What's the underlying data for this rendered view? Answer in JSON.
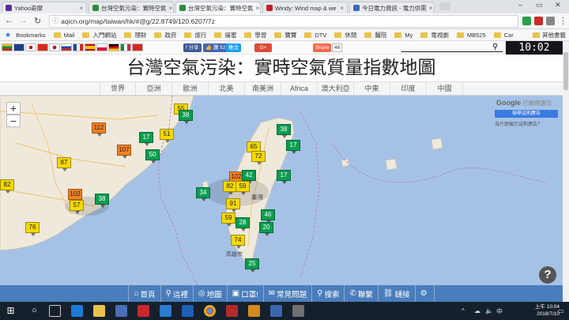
{
  "browser": {
    "tabs": [
      {
        "title": "Yahoo奇摩",
        "fav": "#5a2e9c",
        "active": false
      },
      {
        "title": "台灣空氣污染：實時空氣",
        "fav": "#2f8c3c",
        "active": false
      },
      {
        "title": "台灣空氣污染：實時空氣",
        "fav": "#2f8c3c",
        "active": true
      },
      {
        "title": "Windy: Wind map & we",
        "fav": "#c2202a",
        "active": false
      },
      {
        "title": "今日電力資訊 - 電力供需",
        "fav": "#3b6bb5",
        "active": false
      }
    ],
    "url": "aqicn.org/map/taiwan/hk/#@g/22.8749/120.6207/7z",
    "bookmarks": [
      "Bookmarks",
      "Mail",
      "入門網站",
      "理財",
      "政府",
      "旅行",
      "揚蜜",
      "學習",
      "寶寶",
      "DTV",
      "休閒",
      "醫院",
      "My",
      "電視劇",
      "MB525",
      "Car"
    ],
    "other_bookmarks": "其他書籤"
  },
  "site": {
    "share_fb": "分享",
    "tweet": "推文",
    "like_label": "讚",
    "like_count": "52",
    "gplus": "G+",
    "share_label": "Share",
    "share_count": "46",
    "clock": "10:02",
    "title": "台灣空氣污染：實時空氣質量指數地圖",
    "regions": [
      "世界",
      "亞洲",
      "歐洲",
      "北美",
      "南美洲",
      "Africa",
      "澳大利亞",
      "中東",
      "印度",
      "中國"
    ]
  },
  "map": {
    "google_logo": "Google",
    "google_sub": "已關閉廣告",
    "google_btn": "檢舉這則廣告",
    "google_note": "為什麼顯示這則廣告？",
    "help": "?",
    "city_label": "臺灣",
    "city_label2": "高雄市",
    "markers": [
      {
        "v": "55",
        "c": "#f5d800"
      },
      {
        "v": "38",
        "c": "#0a9e50"
      },
      {
        "v": "112",
        "c": "#f58220"
      },
      {
        "v": "51",
        "c": "#f5d800"
      },
      {
        "v": "17",
        "c": "#0a9e50"
      },
      {
        "v": "107",
        "c": "#f58220"
      },
      {
        "v": "50",
        "c": "#0a9e50"
      },
      {
        "v": "87",
        "c": "#f5d800"
      },
      {
        "v": "82",
        "c": "#f5d800"
      },
      {
        "v": "102",
        "c": "#f58220"
      },
      {
        "v": "57",
        "c": "#f5d800"
      },
      {
        "v": "38",
        "c": "#0a9e50"
      },
      {
        "v": "76",
        "c": "#f5d800"
      },
      {
        "v": "38",
        "c": "#0a9e50"
      },
      {
        "v": "17",
        "c": "#0a9e50"
      },
      {
        "v": "65",
        "c": "#f5d800"
      },
      {
        "v": "72",
        "c": "#f5d800"
      },
      {
        "v": "102",
        "c": "#f58220"
      },
      {
        "v": "42",
        "c": "#0a9e50"
      },
      {
        "v": "17",
        "c": "#0a9e50"
      },
      {
        "v": "82",
        "c": "#f5d800"
      },
      {
        "v": "59",
        "c": "#f5d800"
      },
      {
        "v": "34",
        "c": "#0a9e50"
      },
      {
        "v": "91",
        "c": "#f5d800"
      },
      {
        "v": "46",
        "c": "#0a9e50"
      },
      {
        "v": "59",
        "c": "#f5d800"
      },
      {
        "v": "28",
        "c": "#0a9e50"
      },
      {
        "v": "20",
        "c": "#0a9e50"
      },
      {
        "v": "74",
        "c": "#f5d800"
      },
      {
        "v": "25",
        "c": "#0a9e50"
      }
    ]
  },
  "bottom_nav": [
    {
      "icon": "home-icon",
      "glyph": "⌂",
      "label": "首頁"
    },
    {
      "icon": "pin-icon",
      "glyph": "⚲",
      "label": "這裡"
    },
    {
      "icon": "globe-icon",
      "glyph": "◎",
      "label": "地圖"
    },
    {
      "icon": "mask-icon",
      "glyph": "▣",
      "label": "口罩!"
    },
    {
      "icon": "chat-icon",
      "glyph": "✉",
      "label": "常見問題"
    },
    {
      "icon": "search-icon",
      "glyph": "⚲",
      "label": "搜索"
    },
    {
      "icon": "contact-icon",
      "glyph": "✆",
      "label": "聯繫"
    },
    {
      "icon": "link-icon",
      "glyph": "⛓",
      "label": "鏈接"
    },
    {
      "icon": "gear-icon",
      "glyph": "⚙",
      "label": ""
    }
  ],
  "taskbar": {
    "time": "上午 10:04",
    "date": "2018/7/10"
  }
}
